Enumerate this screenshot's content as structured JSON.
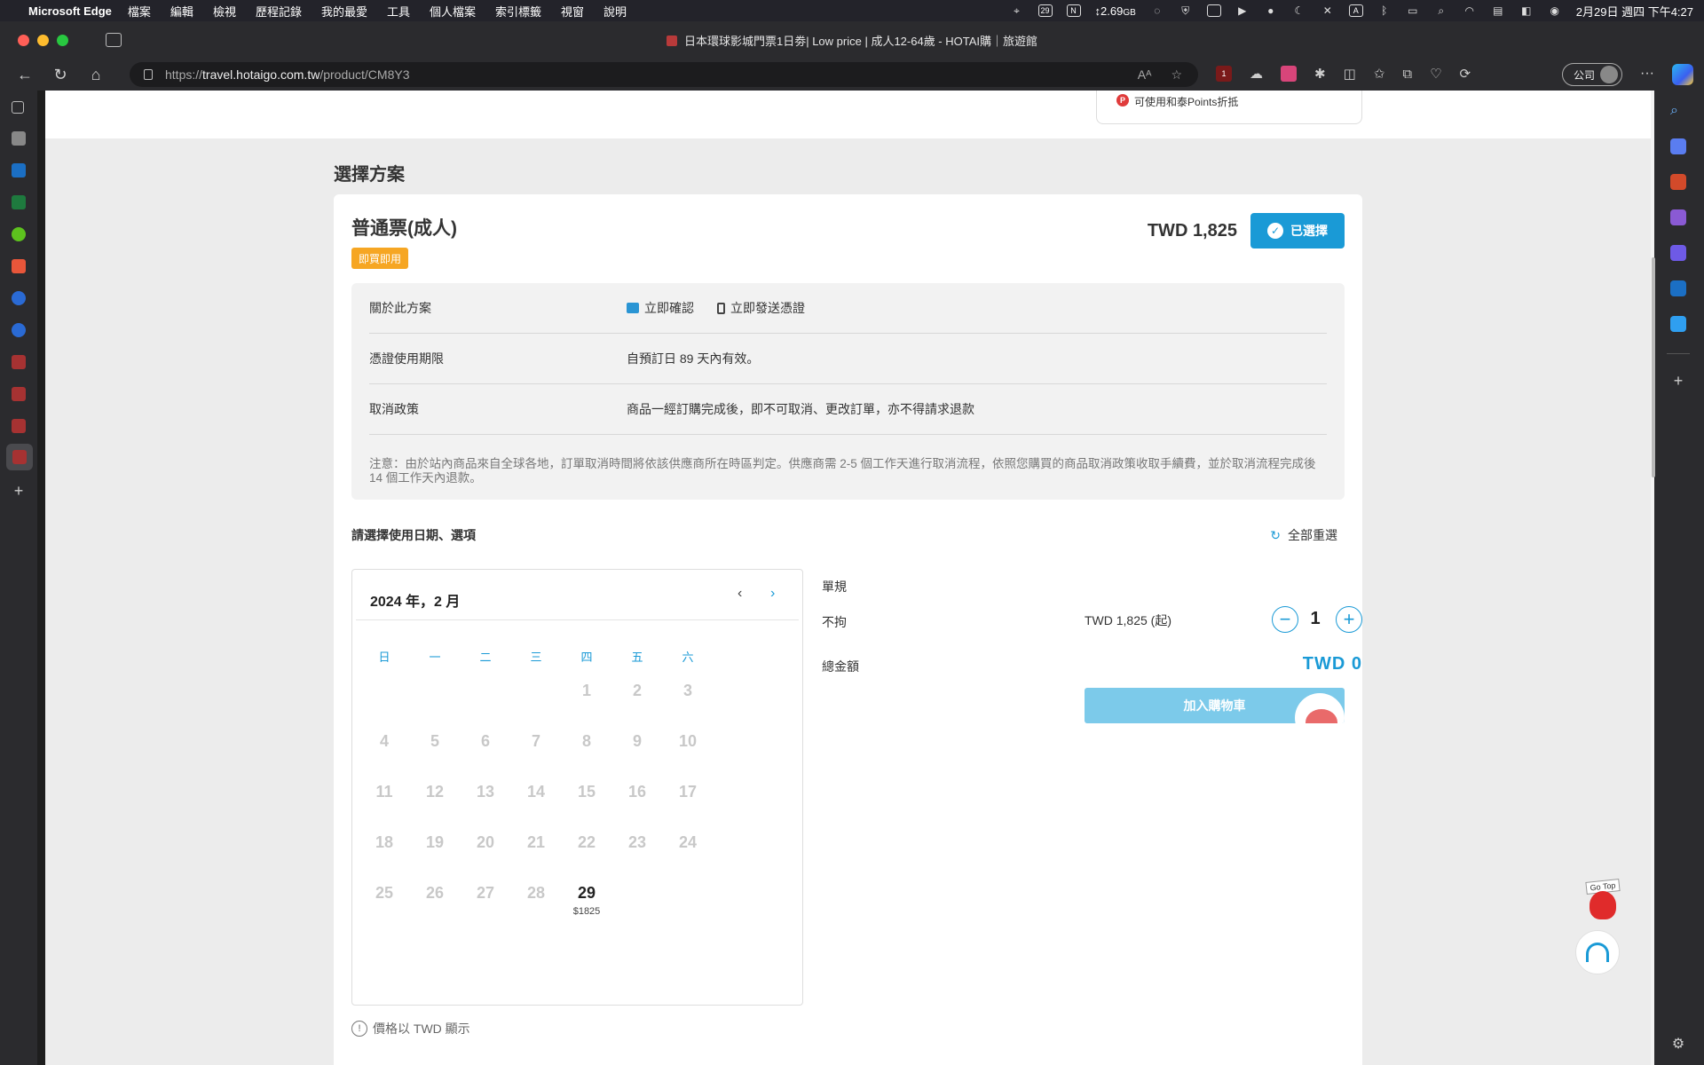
{
  "menubar": {
    "app": "Microsoft Edge",
    "items": [
      "檔案",
      "編輯",
      "檢視",
      "歷程記錄",
      "我的最愛",
      "工具",
      "個人檔案",
      "索引標籤",
      "視窗",
      "說明"
    ],
    "memory": "2.69",
    "memory_unit": "GB",
    "date_badge": "29",
    "clock": "2月29日 週四 下午4:27"
  },
  "browser": {
    "tab_title": "日本環球影城門票1日劵| Low price | 成人12-64歲 - HOTAI購｜旅遊館",
    "url_scheme": "https://",
    "url_host": "travel.hotaigo.com.tw",
    "url_path": "/product/CM8Y3",
    "profile_label": "公司",
    "ext_badge_count": "1"
  },
  "points_card": {
    "text": "可使用和泰Points折抵"
  },
  "section": {
    "title": "選擇方案"
  },
  "plan": {
    "name": "普通票(成人)",
    "badge": "即買即用",
    "price": "TWD 1,825",
    "selected_label": "已選擇",
    "about_label": "關於此方案",
    "feature_confirm": "立即確認",
    "feature_voucher": "立即發送憑證",
    "validity_label": "憑證使用期限",
    "validity_value": "自預訂日 89 天內有效。",
    "cancel_label": "取消政策",
    "cancel_value": "商品一經訂購完成後，即不可取消、更改訂單，亦不得請求退款",
    "note": "注意：由於站內商品來自全球各地，訂單取消時間將依該供應商所在時區判定。供應商需 2-5 個工作天進行取消流程，依照您購買的商品取消政策收取手續費，並於取消流程完成後14 個工作天內退款。"
  },
  "booking": {
    "title": "請選擇使用日期、選項",
    "reset_label": "全部重選",
    "calendar_month": "2024 年，2 月",
    "weekdays": [
      "日",
      "一",
      "二",
      "三",
      "四",
      "五",
      "六"
    ],
    "days": [
      "1",
      "2",
      "3",
      "4",
      "5",
      "6",
      "7",
      "8",
      "9",
      "10",
      "11",
      "12",
      "13",
      "14",
      "15",
      "16",
      "17",
      "18",
      "19",
      "20",
      "21",
      "22",
      "23",
      "24",
      "25",
      "26",
      "27",
      "28",
      "29"
    ],
    "available_day": "29",
    "available_day_price": "$1825",
    "option_group": "單規",
    "option_name": "不拘",
    "option_price": "TWD 1,825 (起)",
    "quantity": "1",
    "total_label": "總金額",
    "total_value": "TWD 0",
    "add_to_cart": "加入購物車",
    "currency_note": "價格以 TWD 顯示"
  },
  "floating": {
    "gotop_label": "Go Top"
  }
}
